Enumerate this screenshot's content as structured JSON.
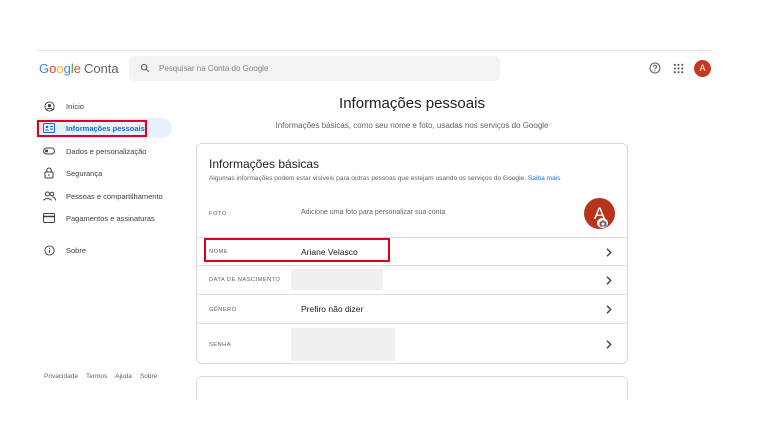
{
  "header": {
    "logo": {
      "letters": [
        "G",
        "o",
        "o",
        "g",
        "l",
        "e"
      ],
      "product": "Conta"
    },
    "search_placeholder": "Pesquisar na Conta do Google",
    "avatar_letter": "A",
    "icons": {
      "search": "search-icon",
      "help": "help-icon",
      "apps": "apps-grid-icon"
    }
  },
  "sidebar": {
    "items": [
      {
        "label": "Início",
        "icon": "home-icon"
      },
      {
        "label": "Informações pessoais",
        "icon": "id-card-icon",
        "active": true
      },
      {
        "label": "Dados e personalização",
        "icon": "toggle-icon"
      },
      {
        "label": "Segurança",
        "icon": "lock-icon"
      },
      {
        "label": "Pessoas e compartilhamento",
        "icon": "people-icon"
      },
      {
        "label": "Pagamentos e assinaturas",
        "icon": "credit-card-icon"
      },
      {
        "label": "Sobre",
        "icon": "info-icon"
      }
    ],
    "footer": [
      "Privacidade",
      "Termos",
      "Ajuda",
      "Sobre"
    ]
  },
  "main": {
    "title": "Informações pessoais",
    "subtitle": "Informações básicas, como seu nome e foto, usadas nos serviços do Google",
    "basic_info": {
      "title": "Informações básicas",
      "description": "Algumas informações podem estar visíveis para outras pessoas que estejam usando os serviços do Google.",
      "learn_more": "Saiba mais",
      "rows": [
        {
          "label": "FOTO",
          "value": "Adicione uma foto para personalizar sua conta",
          "avatar_letter": "A"
        },
        {
          "label": "NOME",
          "value": "Ariane Velasco"
        },
        {
          "label": "DATA DE NASCIMENTO",
          "value": ""
        },
        {
          "label": "GÊNERO",
          "value": "Prefiro não dizer"
        },
        {
          "label": "SENHA",
          "value": ""
        }
      ]
    }
  },
  "colors": {
    "highlight": "#e0001b",
    "accent": "#1a73e8",
    "avatar": "#c5391e"
  }
}
